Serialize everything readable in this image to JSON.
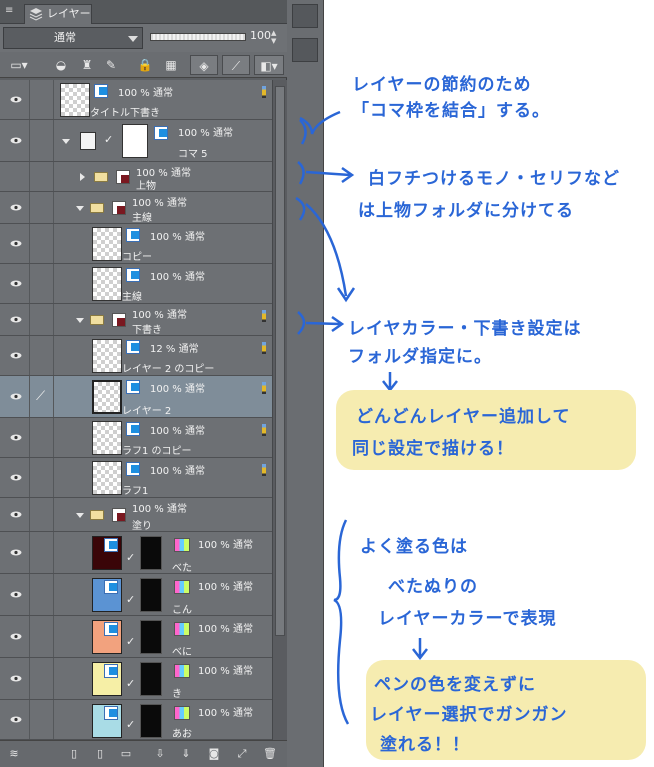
{
  "panel": {
    "tab_label": "レイヤー",
    "blend_mode": "通常",
    "opacity": 100,
    "opacity_label": "100"
  },
  "layers": [
    {
      "pct": "100 % 通常",
      "name": "タイトル下書き"
    },
    {
      "pct": "100 % 通常",
      "name": "コマ 5"
    },
    {
      "pct": "100 % 通常",
      "name": "上物"
    },
    {
      "pct": "100 % 通常",
      "name": "主線"
    },
    {
      "pct": "100 % 通常",
      "name": "コピー"
    },
    {
      "pct": "100 % 通常",
      "name": "主線"
    },
    {
      "pct": "100 % 通常",
      "name": "下書き"
    },
    {
      "pct": "12 % 通常",
      "name": "レイヤー 2 のコピー"
    },
    {
      "pct": "100 % 通常",
      "name": "レイヤー 2"
    },
    {
      "pct": "100 % 通常",
      "name": "ラフ1 のコピー"
    },
    {
      "pct": "100 % 通常",
      "name": "ラフ1"
    },
    {
      "pct": "100 % 通常",
      "name": "塗り"
    },
    {
      "pct": "100 % 通常",
      "name": "べた",
      "color": "#3a0508"
    },
    {
      "pct": "100 % 通常",
      "name": "こん",
      "color": "#5b93d3"
    },
    {
      "pct": "100 % 通常",
      "name": "べに",
      "color": "#f2a27e"
    },
    {
      "pct": "100 % 通常",
      "name": "き",
      "color": "#f6efa6"
    },
    {
      "pct": "100 % 通常",
      "name": "あお",
      "color": "#a9dce6"
    }
  ],
  "notes": {
    "n1a": "レイヤーの節約のため",
    "n1b": "「コマ枠を結合」する。",
    "n2a": "白フチつけるモノ・セリフなど",
    "n2b": "は上物フォルダに分けてる",
    "n3a": "レイヤカラー・下書き設定は",
    "n3b": "フォルダ指定に。",
    "n4a": "どんどんレイヤー追加して",
    "n4b": "同じ設定で描ける！",
    "n5a": "よく塗る色は",
    "n5b": "べたぬりの",
    "n5c": "レイヤーカラーで表現",
    "n6a": "ペンの色を変えずに",
    "n6b": "レイヤー選択でガンガン",
    "n6c": "塗れる！！"
  },
  "colors": {
    "annotation": "#2a66d6",
    "highlight": "#f6ecb0",
    "selected_row": "#7f8d99"
  }
}
